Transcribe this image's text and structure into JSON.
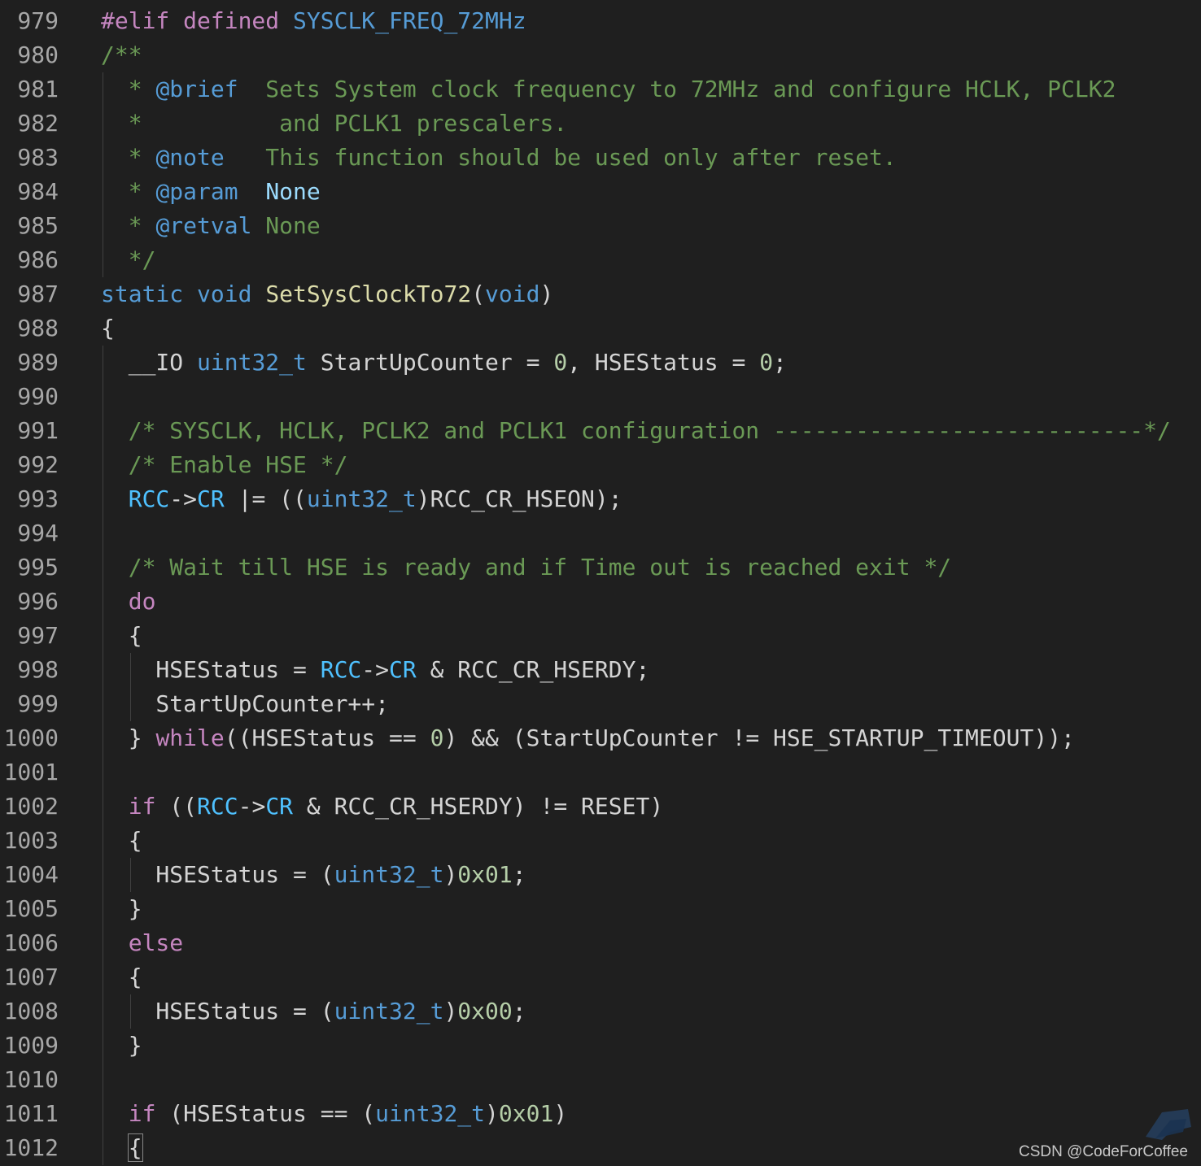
{
  "editor": {
    "lines": [
      {
        "num": "979",
        "indent": 0,
        "tokens": [
          {
            "t": "#elif defined ",
            "c": "kw"
          },
          {
            "t": "SYSCLK_FREQ_72MHz",
            "c": "ty"
          }
        ]
      },
      {
        "num": "980",
        "indent": 0,
        "tokens": [
          {
            "t": "/**",
            "c": "cmt"
          }
        ]
      },
      {
        "num": "981",
        "indent": 1,
        "tokens": [
          {
            "t": "  * ",
            "c": "cmt"
          },
          {
            "t": "@brief",
            "c": "doc"
          },
          {
            "t": "  Sets System clock frequency to 72MHz and configure HCLK, PCLK2",
            "c": "cmt"
          }
        ]
      },
      {
        "num": "982",
        "indent": 1,
        "tokens": [
          {
            "t": "  *          and PCLK1 prescalers.",
            "c": "cmt"
          }
        ]
      },
      {
        "num": "983",
        "indent": 1,
        "tokens": [
          {
            "t": "  * ",
            "c": "cmt"
          },
          {
            "t": "@note",
            "c": "doc"
          },
          {
            "t": "   This function should be used only after reset.",
            "c": "cmt"
          }
        ]
      },
      {
        "num": "984",
        "indent": 1,
        "tokens": [
          {
            "t": "  * ",
            "c": "cmt"
          },
          {
            "t": "@param",
            "c": "doc"
          },
          {
            "t": "  ",
            "c": "cmt"
          },
          {
            "t": "None",
            "c": "id"
          }
        ]
      },
      {
        "num": "985",
        "indent": 1,
        "tokens": [
          {
            "t": "  * ",
            "c": "cmt"
          },
          {
            "t": "@retval",
            "c": "doc"
          },
          {
            "t": " None",
            "c": "cmt"
          }
        ]
      },
      {
        "num": "986",
        "indent": 1,
        "tokens": [
          {
            "t": "  */",
            "c": "cmt"
          }
        ]
      },
      {
        "num": "987",
        "indent": 0,
        "tokens": [
          {
            "t": "static ",
            "c": "ty"
          },
          {
            "t": "void ",
            "c": "ty"
          },
          {
            "t": "SetSysClockTo72",
            "c": "fn"
          },
          {
            "t": "(",
            "c": "pl"
          },
          {
            "t": "void",
            "c": "ty"
          },
          {
            "t": ")",
            "c": "pl"
          }
        ]
      },
      {
        "num": "988",
        "indent": 0,
        "tokens": [
          {
            "t": "{",
            "c": "pl"
          }
        ]
      },
      {
        "num": "989",
        "indent": 1,
        "tokens": [
          {
            "t": "  __IO ",
            "c": "pl"
          },
          {
            "t": "uint32_t",
            "c": "ty"
          },
          {
            "t": " StartUpCounter = ",
            "c": "pl"
          },
          {
            "t": "0",
            "c": "num"
          },
          {
            "t": ", HSEStatus = ",
            "c": "pl"
          },
          {
            "t": "0",
            "c": "num"
          },
          {
            "t": ";",
            "c": "pl"
          }
        ]
      },
      {
        "num": "990",
        "indent": 1,
        "tokens": []
      },
      {
        "num": "991",
        "indent": 1,
        "tokens": [
          {
            "t": "  /* SYSCLK, HCLK, PCLK2 and PCLK1 configuration ---------------------------*/",
            "c": "cmt"
          }
        ]
      },
      {
        "num": "992",
        "indent": 1,
        "tokens": [
          {
            "t": "  /* Enable HSE */",
            "c": "cmt"
          }
        ]
      },
      {
        "num": "993",
        "indent": 1,
        "tokens": [
          {
            "t": "  ",
            "c": "pl"
          },
          {
            "t": "RCC",
            "c": "mac"
          },
          {
            "t": "->",
            "c": "pl"
          },
          {
            "t": "CR",
            "c": "mac"
          },
          {
            "t": " |= ((",
            "c": "pl"
          },
          {
            "t": "uint32_t",
            "c": "ty"
          },
          {
            "t": ")RCC_CR_HSEON);",
            "c": "pl"
          }
        ]
      },
      {
        "num": "994",
        "indent": 1,
        "tokens": []
      },
      {
        "num": "995",
        "indent": 1,
        "tokens": [
          {
            "t": "  /* Wait till HSE is ready and if Time out is reached exit */",
            "c": "cmt"
          }
        ]
      },
      {
        "num": "996",
        "indent": 1,
        "tokens": [
          {
            "t": "  ",
            "c": "pl"
          },
          {
            "t": "do",
            "c": "kw"
          }
        ]
      },
      {
        "num": "997",
        "indent": 1,
        "tokens": [
          {
            "t": "  {",
            "c": "pl"
          }
        ]
      },
      {
        "num": "998",
        "indent": 2,
        "tokens": [
          {
            "t": "    HSEStatus = ",
            "c": "pl"
          },
          {
            "t": "RCC",
            "c": "mac"
          },
          {
            "t": "->",
            "c": "pl"
          },
          {
            "t": "CR",
            "c": "mac"
          },
          {
            "t": " & RCC_CR_HSERDY;",
            "c": "pl"
          }
        ]
      },
      {
        "num": "999",
        "indent": 2,
        "tokens": [
          {
            "t": "    StartUpCounter++;",
            "c": "pl"
          }
        ]
      },
      {
        "num": "1000",
        "indent": 1,
        "tokens": [
          {
            "t": "  } ",
            "c": "pl"
          },
          {
            "t": "while",
            "c": "kw"
          },
          {
            "t": "((HSEStatus == ",
            "c": "pl"
          },
          {
            "t": "0",
            "c": "num"
          },
          {
            "t": ") && (StartUpCounter != HSE_STARTUP_TIMEOUT));",
            "c": "pl"
          }
        ]
      },
      {
        "num": "1001",
        "indent": 1,
        "tokens": []
      },
      {
        "num": "1002",
        "indent": 1,
        "tokens": [
          {
            "t": "  ",
            "c": "pl"
          },
          {
            "t": "if",
            "c": "kw"
          },
          {
            "t": " ((",
            "c": "pl"
          },
          {
            "t": "RCC",
            "c": "mac"
          },
          {
            "t": "->",
            "c": "pl"
          },
          {
            "t": "CR",
            "c": "mac"
          },
          {
            "t": " & RCC_CR_HSERDY) != RESET)",
            "c": "pl"
          }
        ]
      },
      {
        "num": "1003",
        "indent": 1,
        "tokens": [
          {
            "t": "  {",
            "c": "pl"
          }
        ]
      },
      {
        "num": "1004",
        "indent": 2,
        "tokens": [
          {
            "t": "    HSEStatus = (",
            "c": "pl"
          },
          {
            "t": "uint32_t",
            "c": "ty"
          },
          {
            "t": ")",
            "c": "pl"
          },
          {
            "t": "0x01",
            "c": "num"
          },
          {
            "t": ";",
            "c": "pl"
          }
        ]
      },
      {
        "num": "1005",
        "indent": 1,
        "tokens": [
          {
            "t": "  }",
            "c": "pl"
          }
        ]
      },
      {
        "num": "1006",
        "indent": 1,
        "tokens": [
          {
            "t": "  ",
            "c": "pl"
          },
          {
            "t": "else",
            "c": "kw"
          }
        ]
      },
      {
        "num": "1007",
        "indent": 1,
        "tokens": [
          {
            "t": "  {",
            "c": "pl"
          }
        ]
      },
      {
        "num": "1008",
        "indent": 2,
        "tokens": [
          {
            "t": "    HSEStatus = (",
            "c": "pl"
          },
          {
            "t": "uint32_t",
            "c": "ty"
          },
          {
            "t": ")",
            "c": "pl"
          },
          {
            "t": "0x00",
            "c": "num"
          },
          {
            "t": ";",
            "c": "pl"
          }
        ]
      },
      {
        "num": "1009",
        "indent": 1,
        "tokens": [
          {
            "t": "  }",
            "c": "pl"
          }
        ]
      },
      {
        "num": "1010",
        "indent": 1,
        "tokens": []
      },
      {
        "num": "1011",
        "indent": 1,
        "tokens": [
          {
            "t": "  ",
            "c": "pl"
          },
          {
            "t": "if",
            "c": "kw"
          },
          {
            "t": " (HSEStatus == (",
            "c": "pl"
          },
          {
            "t": "uint32_t",
            "c": "ty"
          },
          {
            "t": ")",
            "c": "pl"
          },
          {
            "t": "0x01",
            "c": "num"
          },
          {
            "t": ")",
            "c": "pl"
          }
        ]
      },
      {
        "num": "1012",
        "indent": 1,
        "tokens": [
          {
            "t": "  ",
            "c": "pl"
          },
          {
            "t": "{",
            "c": "pl",
            "cursor": true
          }
        ]
      }
    ]
  },
  "watermark": {
    "text": "CSDN @CodeForCoffee"
  },
  "colors": {
    "background": "#1f1f1f",
    "line_number": "#a7a7a7",
    "keyword": "#c586c0",
    "type": "#569cd6",
    "function": "#dcdcaa",
    "number": "#b5cea8",
    "comment": "#6a9955",
    "macro": "#4fc1ff",
    "text": "#d4d4d4"
  }
}
